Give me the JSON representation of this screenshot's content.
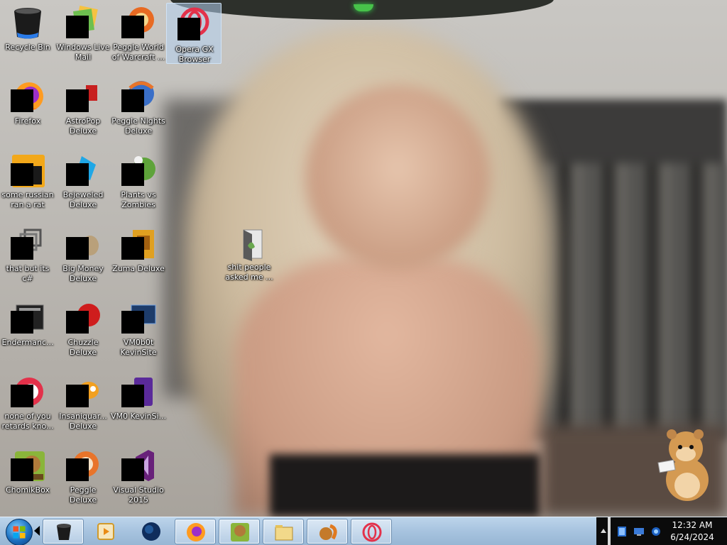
{
  "desktop": {
    "icons": [
      {
        "label": "Recycle Bin",
        "icon": "recycle-bin-icon"
      },
      {
        "label": "Windows Live Mail",
        "icon": "windows-live-mail-icon"
      },
      {
        "label": "Peggle World of Warcraft ...",
        "icon": "peggle-wow-icon"
      },
      {
        "label": "Opera GX Browser",
        "icon": "opera-gx-icon"
      },
      {
        "label": "Firefox",
        "icon": "firefox-icon"
      },
      {
        "label": "AstroPop Deluxe",
        "icon": "astropop-icon"
      },
      {
        "label": "Peggle Nights Deluxe",
        "icon": "peggle-nights-icon"
      },
      {
        "label": "some russian ran a rat",
        "icon": "rat-app-icon"
      },
      {
        "label": "Bejeweled Deluxe",
        "icon": "bejeweled-icon"
      },
      {
        "label": "Plants vs Zombies",
        "icon": "plants-vs-zombies-icon"
      },
      {
        "label": "that but its c#",
        "icon": "csharp-app-icon"
      },
      {
        "label": "Big Money Deluxe",
        "icon": "big-money-icon"
      },
      {
        "label": "Zuma Deluxe",
        "icon": "zuma-icon"
      },
      {
        "label": "Endermanc...",
        "icon": "endermanch-icon"
      },
      {
        "label": "Chuzzle Deluxe",
        "icon": "chuzzle-icon"
      },
      {
        "label": "VM0b0t KevinSite",
        "icon": "vm0b0t-icon"
      },
      {
        "label": "none of you retards kno...",
        "icon": "opera-red-icon"
      },
      {
        "label": "Insaniquar... Deluxe",
        "icon": "insaniquarium-icon"
      },
      {
        "label": "VM0 KevinSi...",
        "icon": "vm0-icon"
      },
      {
        "label": "ChomikBox",
        "icon": "chomikbox-icon"
      },
      {
        "label": "Peggle Deluxe",
        "icon": "peggle-icon"
      },
      {
        "label": "Visual Studio 2015",
        "icon": "visual-studio-icon"
      },
      {
        "label": "shit people asked me ...",
        "icon": "folder-icon"
      }
    ]
  },
  "taskbar": {
    "apps": [
      {
        "name": "task-recycle-bin",
        "icon": "recycle-bin-icon"
      },
      {
        "name": "task-media-player",
        "icon": "media-player-icon"
      },
      {
        "name": "task-globe",
        "icon": "globe-icon"
      },
      {
        "name": "task-firefox",
        "icon": "firefox-icon"
      },
      {
        "name": "task-chomikbox",
        "icon": "chomikbox-icon"
      },
      {
        "name": "task-explorer",
        "icon": "explorer-icon"
      },
      {
        "name": "task-squirrel",
        "icon": "squirrel-icon"
      },
      {
        "name": "task-opera",
        "icon": "opera-gx-icon"
      }
    ],
    "clock": {
      "time": "12:32 AM",
      "date": "6/24/2024"
    },
    "colors": {
      "bar": "#a7c3df",
      "tray": "#0b0b0b",
      "opera": "#e3314a"
    }
  }
}
